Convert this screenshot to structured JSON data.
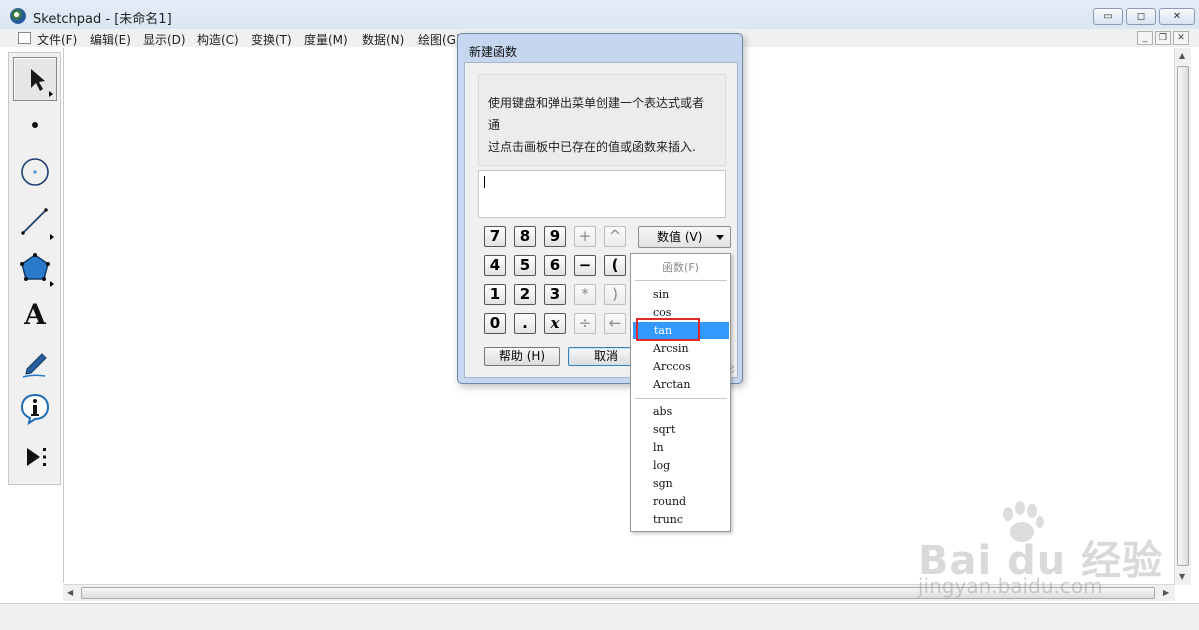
{
  "window": {
    "title": "Sketchpad  - [未命名1]",
    "controls": {
      "minimize": "▭",
      "maximize": "◻",
      "close": "✕"
    }
  },
  "menubar": {
    "items": [
      "文件(F)",
      "编辑(E)",
      "显示(D)",
      "构造(C)",
      "变换(T)",
      "度量(M)",
      "数据(N)",
      "绘图(G)"
    ]
  },
  "toolbox": {
    "tools": [
      "arrow-tool",
      "point-tool",
      "compass-tool",
      "line-tool",
      "polygon-tool",
      "text-tool",
      "marker-tool",
      "info-tool",
      "custom-tool"
    ],
    "text_tool_glyph": "A"
  },
  "dialog": {
    "title": "新建函数",
    "description_line1": "使用键盘和弹出菜单创建一个表达式或者通",
    "description_line2": "过点击画板中已存在的值或函数来插入.",
    "expression_value": "",
    "keypad": [
      [
        "7",
        "8",
        "9",
        "+",
        "^"
      ],
      [
        "4",
        "5",
        "6",
        "−",
        "("
      ],
      [
        "1",
        "2",
        "3",
        "*",
        ")"
      ],
      [
        "0",
        ".",
        "x",
        "÷",
        "←"
      ]
    ],
    "values_button": "数值 (V)",
    "help_button": "帮助 (H)",
    "cancel_button": "取消"
  },
  "function_menu": {
    "header": "函数(F)",
    "group1": [
      "sin",
      "cos",
      "tan",
      "Arcsin",
      "Arccos",
      "Arctan"
    ],
    "group2": [
      "abs",
      "sqrt",
      "ln",
      "log",
      "sgn",
      "round",
      "trunc"
    ],
    "highlighted": "tan"
  },
  "watermark": {
    "brand": "Bai  du 经验",
    "url": "jingyan.baidu.com"
  },
  "colors": {
    "highlight": "#3399ff",
    "annotation_box": "#e0282a",
    "dialog_frame": "#c5d6ee"
  }
}
